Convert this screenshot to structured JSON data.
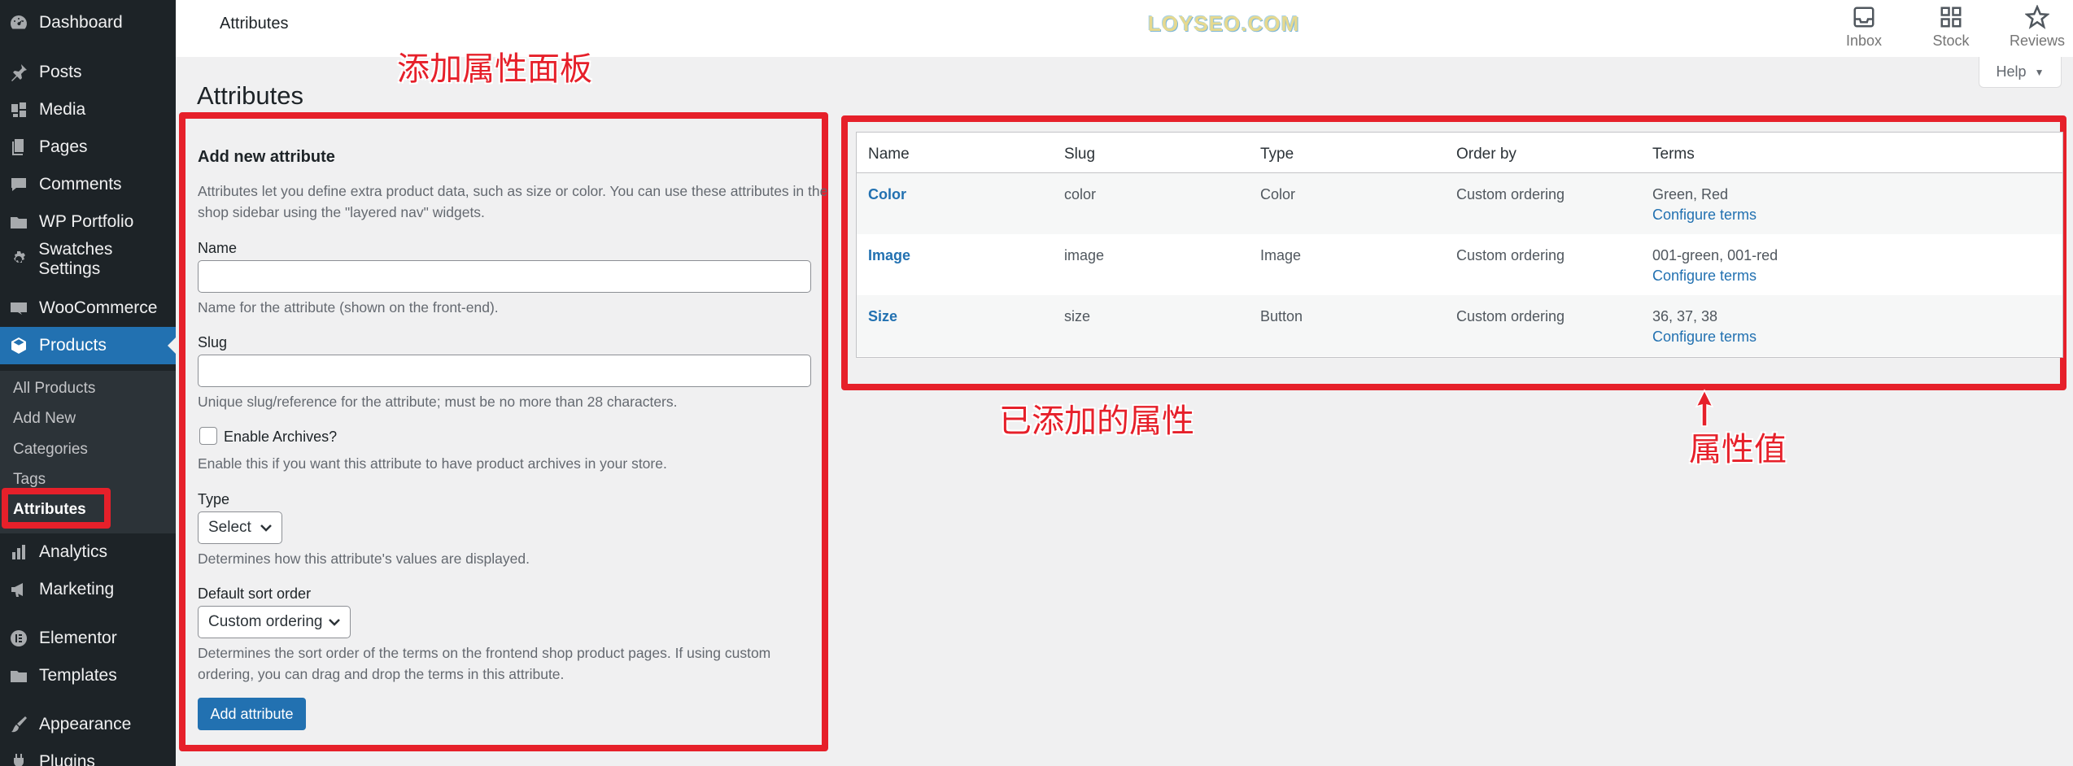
{
  "sidebar": {
    "items": [
      {
        "label": "Dashboard",
        "icon": "dashboard-icon"
      },
      {
        "label": "Posts",
        "icon": "pin-icon"
      },
      {
        "label": "Media",
        "icon": "media-icon"
      },
      {
        "label": "Pages",
        "icon": "pages-icon"
      },
      {
        "label": "Comments",
        "icon": "comment-icon"
      },
      {
        "label": "WP Portfolio",
        "icon": "folder-icon"
      },
      {
        "label": "Swatches Settings",
        "icon": "gear-icon"
      },
      {
        "label": "WooCommerce",
        "icon": "woo-icon"
      },
      {
        "label": "Products",
        "icon": "box-icon"
      },
      {
        "label": "Analytics",
        "icon": "bar-chart-icon"
      },
      {
        "label": "Marketing",
        "icon": "megaphone-icon"
      },
      {
        "label": "Elementor",
        "icon": "elementor-icon"
      },
      {
        "label": "Templates",
        "icon": "folder-icon"
      },
      {
        "label": "Appearance",
        "icon": "brush-icon"
      },
      {
        "label": "Plugins",
        "icon": "plugin-icon"
      }
    ],
    "submenu": [
      "All Products",
      "Add New",
      "Categories",
      "Tags",
      "Attributes"
    ]
  },
  "topbar": {
    "title": "Attributes",
    "watermark": "LOYSEO.COM",
    "actions": [
      {
        "label": "Inbox",
        "icon": "inbox-icon"
      },
      {
        "label": "Stock",
        "icon": "stock-icon"
      },
      {
        "label": "Reviews",
        "icon": "star-icon"
      }
    ]
  },
  "help": {
    "label": "Help"
  },
  "page_title": "Attributes",
  "annotations": {
    "form_panel": "添加属性面板",
    "added_attributes": "已添加的属性",
    "attribute_values": "属性值"
  },
  "form": {
    "heading": "Add new attribute",
    "intro_line1": "Attributes let you define extra product data, such as size or color. You can use these attributes in the",
    "intro_line2": "shop sidebar using the \"layered nav\" widgets.",
    "name_label": "Name",
    "name_value": "",
    "name_desc": "Name for the attribute (shown on the front-end).",
    "slug_label": "Slug",
    "slug_value": "",
    "slug_desc": "Unique slug/reference for the attribute; must be no more than 28 characters.",
    "archives_label": "Enable Archives?",
    "archives_desc": "Enable this if you want this attribute to have product archives in your store.",
    "type_label": "Type",
    "type_value": "Select",
    "type_desc": "Determines how this attribute's values are displayed.",
    "sort_label": "Default sort order",
    "sort_value": "Custom ordering",
    "sort_desc_line1": "Determines the sort order of the terms on the frontend shop product pages. If using custom",
    "sort_desc_line2": "ordering, you can drag and drop the terms in this attribute.",
    "submit_label": "Add attribute"
  },
  "table": {
    "headers": [
      "Name",
      "Slug",
      "Type",
      "Order by",
      "Terms"
    ],
    "rows": [
      {
        "name": "Color",
        "slug": "color",
        "type": "Color",
        "order": "Custom ordering",
        "terms": "Green, Red",
        "configure": "Configure terms"
      },
      {
        "name": "Image",
        "slug": "image",
        "type": "Image",
        "order": "Custom ordering",
        "terms": "001-green, 001-red",
        "configure": "Configure terms"
      },
      {
        "name": "Size",
        "slug": "size",
        "type": "Button",
        "order": "Custom ordering",
        "terms": "36, 37, 38",
        "configure": "Configure terms"
      }
    ]
  },
  "colors": {
    "sidebar_bg": "#1d2327",
    "accent": "#2271b1",
    "annotation": "#e6202a"
  }
}
